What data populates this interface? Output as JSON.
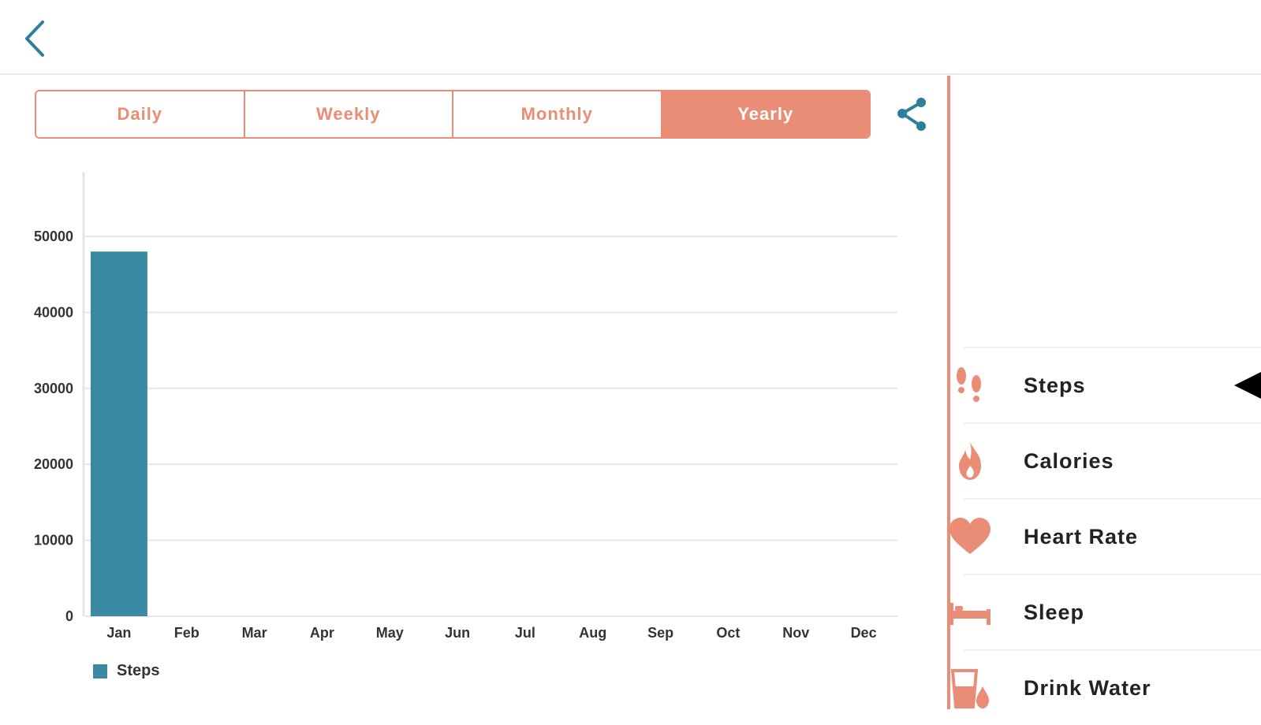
{
  "colors": {
    "accent": "#e98d76",
    "bar": "#3a8aa3",
    "back": "#2f7f9a",
    "grid": "#e6e6e6"
  },
  "tabs": [
    {
      "label": "Daily",
      "active": false
    },
    {
      "label": "Weekly",
      "active": false
    },
    {
      "label": "Monthly",
      "active": false
    },
    {
      "label": "Yearly",
      "active": true
    }
  ],
  "icons": {
    "back": "chevron-left-icon",
    "share": "share-icon"
  },
  "chart_data": {
    "type": "bar",
    "categories": [
      "Jan",
      "Feb",
      "Mar",
      "Apr",
      "May",
      "Jun",
      "Jul",
      "Aug",
      "Sep",
      "Oct",
      "Nov",
      "Dec"
    ],
    "series": [
      {
        "name": "Steps",
        "values": [
          48000,
          0,
          0,
          0,
          0,
          0,
          0,
          0,
          0,
          0,
          0,
          0
        ]
      }
    ],
    "yticks": [
      "0",
      "10000",
      "20000",
      "30000",
      "40000",
      "50000"
    ],
    "ylim": [
      0,
      50000
    ],
    "grid": true,
    "legend": "bottom-left"
  },
  "legend": {
    "label": "Steps"
  },
  "menu": {
    "items": [
      {
        "label": "Steps",
        "icon": "footprints-icon",
        "selected": true
      },
      {
        "label": "Calories",
        "icon": "flame-icon",
        "selected": false
      },
      {
        "label": "Heart Rate",
        "icon": "heart-icon",
        "selected": false
      },
      {
        "label": "Sleep",
        "icon": "bed-icon",
        "selected": false
      },
      {
        "label": "Drink Water",
        "icon": "water-glass-icon",
        "selected": false
      }
    ]
  }
}
